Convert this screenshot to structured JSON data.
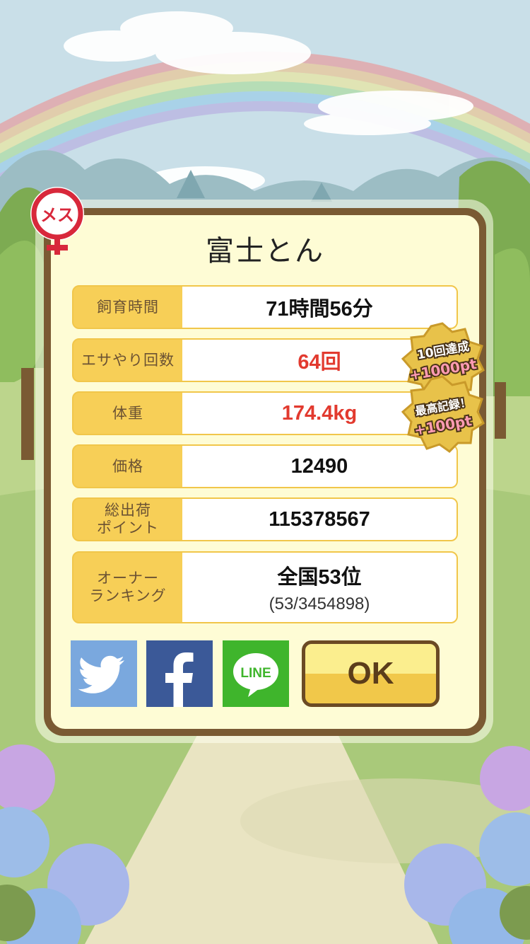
{
  "pig": {
    "name": "富士とん",
    "gender": "メス"
  },
  "stats": [
    {
      "label": "飼育時間",
      "value": "71時間56分",
      "highlight": false
    },
    {
      "label": "エサやり回数",
      "value": "64回",
      "highlight": true
    },
    {
      "label": "体重",
      "value": "174.4kg",
      "highlight": true
    },
    {
      "label": "価格",
      "value": "12490",
      "highlight": false
    },
    {
      "label": "総出荷\nポイント",
      "value": "115378567",
      "highlight": false
    },
    {
      "label": "オーナー\nランキング",
      "value": "全国53位",
      "sub": "(53/3454898)",
      "highlight": false
    }
  ],
  "badges": [
    {
      "line1": "10回達成",
      "line2": "+1000pt"
    },
    {
      "line1": "最高記録！",
      "line2": "+100pt"
    }
  ],
  "share": {
    "twitter": "twitter-icon",
    "facebook": "facebook-icon",
    "line": "LINE"
  },
  "ok_label": "OK",
  "colors": {
    "accent": "#f7cf57",
    "highlight": "#e23a2f",
    "frame": "#7a5a33"
  }
}
